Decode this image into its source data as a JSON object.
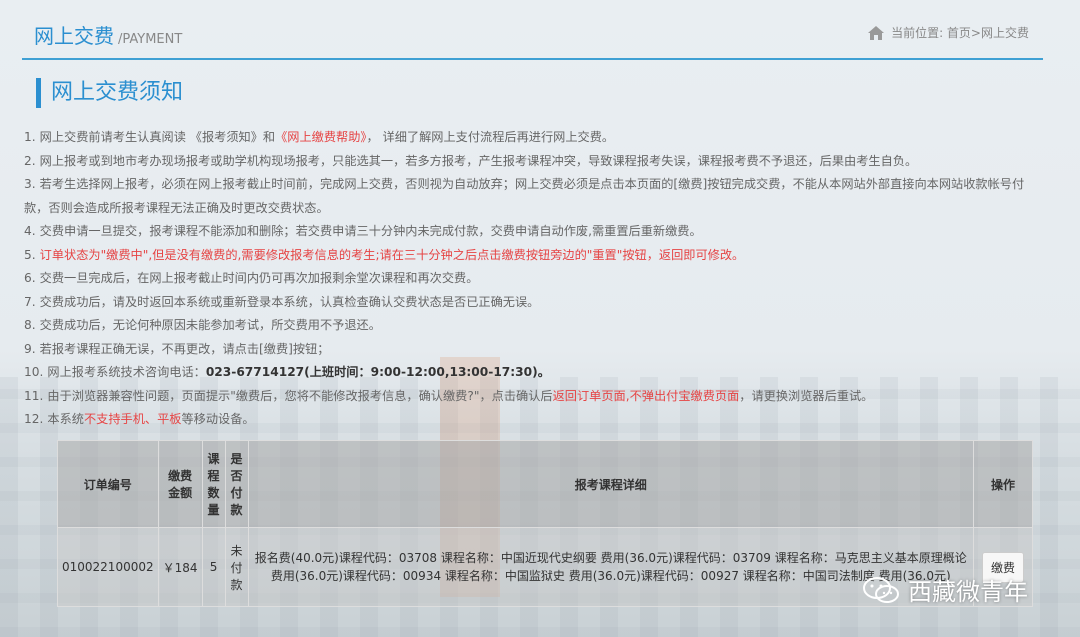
{
  "header": {
    "title": "网上交费",
    "subtitle": "/PAYMENT",
    "breadcrumb": "当前位置: 首页>网上交费"
  },
  "section_title": "网上交费须知",
  "notice": [
    {
      "n": "1.",
      "parts": [
        {
          "t": "网上交费前请考生认真阅读 《报考须知》和",
          "c": ""
        },
        {
          "t": "《网上缴费帮助》",
          "c": "red"
        },
        {
          "t": "， 详细了解网上支付流程后再进行网上交费。",
          "c": ""
        }
      ]
    },
    {
      "n": "2.",
      "parts": [
        {
          "t": "网上报考或到地市考办现场报考或助学机构现场报考，只能选其一，若多方报考，产生报考课程冲突，导致课程报考失误，课程报考费不予退还，后果由考生自负。",
          "c": ""
        }
      ]
    },
    {
      "n": "3.",
      "parts": [
        {
          "t": "若考生选择网上报考，必须在网上报考截止时间前，完成网上交费，否则视为自动放弃；网上交费必须是点击本页面的[缴费]按钮完成交费，不能从本网站外部直接向本网站收款帐号付款，否则会造成所报考课程无法正确及时更改交费状态。",
          "c": ""
        }
      ]
    },
    {
      "n": "4.",
      "parts": [
        {
          "t": "交费申请一旦提交，报考课程不能添加和删除；若交费申请三十分钟内未完成付款，交费申请自动作废,需重置后重新缴费。",
          "c": ""
        }
      ]
    },
    {
      "n": "5.",
      "parts": [
        {
          "t": "订单状态为\"缴费中\",但是没有缴费的,需要修改报考信息的考生;请在三十分钟之后点击缴费按钮旁边的\"重置\"按钮，返回即可修改。",
          "c": "red"
        }
      ]
    },
    {
      "n": "6.",
      "parts": [
        {
          "t": "交费一旦完成后，在网上报考截止时间内仍可再次加报剩余堂次课程和再次交费。",
          "c": ""
        }
      ]
    },
    {
      "n": "7.",
      "parts": [
        {
          "t": "交费成功后，请及时返回本系统或重新登录本系统，认真检查确认交费状态是否已正确无误。",
          "c": ""
        }
      ]
    },
    {
      "n": "8.",
      "parts": [
        {
          "t": "交费成功后，无论何种原因未能参加考试，所交费用不予退还。",
          "c": ""
        }
      ]
    },
    {
      "n": "9.",
      "parts": [
        {
          "t": "若报考课程正确无误，不再更改，请点击[缴费]按钮；",
          "c": ""
        }
      ]
    },
    {
      "n": "10.",
      "parts": [
        {
          "t": "网上报考系统技术咨询电话：",
          "c": ""
        },
        {
          "t": "023-67714127(上班时间：9:00-12:00,13:00-17:30)。",
          "c": "bold"
        }
      ]
    },
    {
      "n": "11.",
      "parts": [
        {
          "t": "由于浏览器兼容性问题，页面提示\"缴费后，您将不能修改报考信息，确认缴费?\"，点击确认后",
          "c": ""
        },
        {
          "t": "返回订单页面,不弹出付宝缴费页面",
          "c": "red"
        },
        {
          "t": "，请更换浏览器后重试。",
          "c": ""
        }
      ]
    },
    {
      "n": "12.",
      "parts": [
        {
          "t": "本系统",
          "c": ""
        },
        {
          "t": "不支持手机、平板",
          "c": "red"
        },
        {
          "t": "等移动设备。",
          "c": ""
        }
      ]
    }
  ],
  "table": {
    "headers": [
      "订单编号",
      "缴费金额",
      "课程数量",
      "是否付款",
      "报考课程详细",
      "操作"
    ],
    "row": {
      "order_no": "010022100002",
      "amount": "￥184",
      "count": "5",
      "paid": "未付款",
      "detail": "报名费(40.0元)课程代码：03708 课程名称：中国近现代史纲要 费用(36.0元)课程代码：03709 课程名称：马克思主义基本原理概论 费用(36.0元)课程代码：00934 课程名称：中国监狱史 费用(36.0元)课程代码：00927 课程名称：中国司法制度 费用(36.0元)",
      "action": "缴费"
    }
  },
  "watermark": "西藏微青年",
  "colors": {
    "accent": "#2b8fd0",
    "alert": "#e64444"
  }
}
